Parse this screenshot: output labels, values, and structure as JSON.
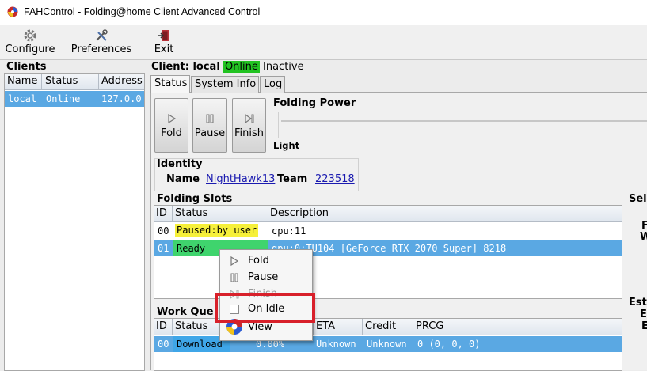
{
  "window": {
    "title": "FAHControl - Folding@home Client Advanced Control",
    "app_icon": "fah-logo-icon"
  },
  "toolbar": {
    "configure_label": "Configure",
    "preferences_label": "Preferences",
    "exit_label": "Exit"
  },
  "clients": {
    "title": "Clients",
    "columns": [
      "Name",
      "Status",
      "Address"
    ],
    "rows": [
      {
        "name": "local",
        "status": "Online",
        "address": "127.0.0"
      }
    ]
  },
  "client_header": {
    "prefix": "Client: local",
    "status": "Online",
    "state": "Inactive"
  },
  "tabs": [
    "Status",
    "System Info",
    "Log"
  ],
  "controls": {
    "fold_label": "Fold",
    "pause_label": "Pause",
    "finish_label": "Finish"
  },
  "folding_power": {
    "title": "Folding Power",
    "level_label": "Light"
  },
  "identity": {
    "title": "Identity",
    "name_label": "Name",
    "name": "NightHawk13",
    "team_label": "Team",
    "team": "223518"
  },
  "slots": {
    "title": "Folding Slots",
    "columns": [
      "ID",
      "Status",
      "Description"
    ],
    "rows": [
      {
        "id": "00",
        "status": "Paused:by user",
        "description": "cpu:11"
      },
      {
        "id": "01",
        "status": "Ready",
        "description": "gpu:0:TU104 [GeForce RTX 2070 Super] 8218"
      }
    ]
  },
  "work_queue": {
    "title": "Work Que",
    "columns": [
      "ID",
      "Status",
      "ETA",
      "Credit",
      "PRCG"
    ],
    "rows": [
      {
        "id": "00",
        "status": "Download",
        "progress": "0.00%",
        "eta": "Unknown",
        "credit": "Unknown",
        "prcg": "0 (0, 0, 0)"
      }
    ]
  },
  "side_panel": {
    "sel": "Sel",
    "f": "F",
    "w": "W",
    "est": "Est",
    "e1": "E",
    "e2": "E"
  },
  "context_menu": {
    "items": [
      {
        "label": "Fold",
        "icon": "play-icon"
      },
      {
        "label": "Pause",
        "icon": "pause-icon"
      },
      {
        "label": "Finish",
        "icon": "finish-icon"
      },
      {
        "label": "On Idle",
        "icon": "checkbox-icon"
      },
      {
        "label": "View",
        "icon": "fah-logo-icon"
      }
    ]
  },
  "colors": {
    "selection": "#5aa8e3",
    "online": "#22c322",
    "paused": "#f6f03a",
    "ready": "#3fd46d",
    "highlight": "#d8202a"
  }
}
